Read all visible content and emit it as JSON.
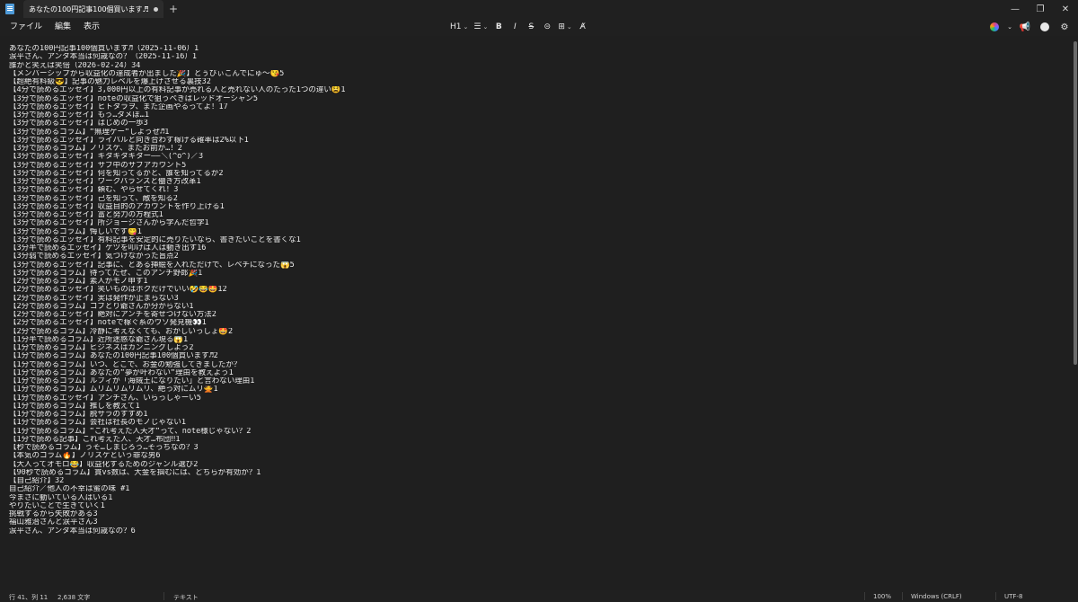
{
  "window": {
    "tab_title": "あなたの100円記事100個買います♬ (2",
    "new_tab": "+",
    "minimize": "—",
    "maximize": "❐",
    "close": "✕"
  },
  "menu": [
    "ファイル",
    "編集",
    "表示"
  ],
  "format_toolbar": {
    "heading": "H1",
    "list": "☰",
    "bold": "B",
    "italic": "I",
    "strike": "S",
    "link": "⊝",
    "table": "⊞",
    "clear": "A̸"
  },
  "document": {
    "lines": [
      "あなたの100円記事100個買います♬（2025-11-06）1",
      "涙平さん、アンタ本当は何歳なの？（2025-11-16）1",
      "誰かと笑えば笑倍（2026-02-24）34",
      "【メンバーシップから収益化の達成者が出ました🎉】とぅびぃこんでにゅ〜😘5",
      "【超絶有料級😎】記事の魅力レベルを爆上げさせる裏技32",
      "【4分で読めるエッセイ】3,000円以上の有料記事が売れる人と売れない人のたった1つの違い😫1",
      "【3分で読めるエッセイ】noteの収益化で狙うべきはレッドオーシャン5",
      "【3分で読めるエッセイ】ヒトタラヲ、また企画やるってよ！17",
      "【3分で読めるエッセイ】もう…ダメぽ…1",
      "【3分で読めるエッセイ】はじめの一歩3",
      "【3分で読めるコラム】“無理ゲー“しようぜ♬1",
      "【3分で読めるエッセイ】ライバルと向き合わず稼げる確率は2%以下1",
      "【3分で読めるコラム】ノリスケ、またお前か…！2",
      "【3分で読めるエッセイ】キタキタキター――＼(^o^)／3",
      "【3分で読めるエッセイ】サブ中のサブアカウント5",
      "【3分で読めるエッセイ】何を知ってるかと、誰を知ってるか2",
      "【3分で読めるエッセイ】ワークバランスと働き方改革1",
      "【3分で読めるエッセイ】頼む、やらせてくれ！3",
      "【3分で読めるエッセイ】己を知って、敵を知る2",
      "【3分で読めるエッセイ】収益目的のアカウントを作り上げる1",
      "【3分で読めるエッセイ】富と努力の方程式1",
      "【3分で読めるエッセイ】所ジョージさんから学んだ哲学1",
      "【3分で読めるコラム】悔しいです😋1",
      "【3分で読めるエッセイ】有料記事を安定的に売りたいなら、書きたいことを書くな1",
      "【3分半で読めるエッセイ】ケツを叩けば人は動き出す16",
      "【3分弱で読めるエッセイ】気づけなかった盲点2",
      "【3分で読めるエッセイ】記事に、とある挿絵を入れただけで、レベチになった😱5",
      "【3分で読めるコラム】待ってたぜ、このアンチ野郎🎉1",
      "【2分で読めるコラム】素人がモノ申す1",
      "【2分で読めるエッセイ】笑いものはボクだけでいい🤣😂🤩12",
      "【2分で読めるエッセイ】実は発作が止まらない3",
      "【2分で読めるコラム】コブとり爺さんが分からない1",
      "【2分で読めるエッセイ】絶対にアンチを寄せつけない方法2",
      "【2分で読めるエッセイ】noteで稼ぐ系のウソ発見機👀1",
      "【2分で読めるコラム】冷静に考えなくても、おかしいっしょ🤩2",
      "【1分半で読めるコラム】近所迷惑な爺さん現る😱1",
      "【1分で読めるコラム】ビジネスはカンニングしよう2",
      "【1分で読めるコラム】あなたの100円記事100個買います♬2",
      "【1分で読めるコラム】いつ、どこで、お金の勉強してきましたか？",
      "【1分で読めるコラム】あなたの“夢が叶わない“理由を教えよう1",
      "【1分で読めるコラム】ルフィが「海賊王になりたい」と言わない理由1",
      "【1分で読めるコラム】ムリムリムリムリ、絶っ対にムリ🙅1",
      "【1分で読めるエッセイ】アンチさん、いらっしゃーい5",
      "【1分で読めるコラム】推しを教えて1",
      "【1分で読めるコラム】脱サラのすすめ1",
      "【1分で読めるコラム】会社は社長のモノじゃない1",
      "【1分で読めるコラム】“これ考えた人天才“って、note様じゃない？2",
      "【1分で読める記事】これ考えた人、天才…布団‼1",
      "【秒で読めるコラム】うそ…しまじろう…そっちなの？3",
      "【本気のコラム🔥】ノリスケという罪な男6",
      "【大人ってオモロ😂】収益化するためのジャンル選び2",
      "【90秒で読めるコラム】貫vs数は、大金を掴むには、どちらが有効か？1",
      "【自己紹介】32",
      "自己紹介／他人の不幸は蜜の味 #1",
      "今まさに動いている人はいる1",
      "やりたいことで生きていく1",
      "挑戦するから失敗がある3",
      "福山雅治さんと涙平さん3",
      "涙平さん、アンタ本当は何歳なの？6"
    ]
  },
  "status": {
    "position": "行 41、列 11",
    "chars": "2,638 文字",
    "mode": "テキスト",
    "zoom": "100%",
    "line_ending": "Windows (CRLF)",
    "encoding": "UTF-8"
  }
}
